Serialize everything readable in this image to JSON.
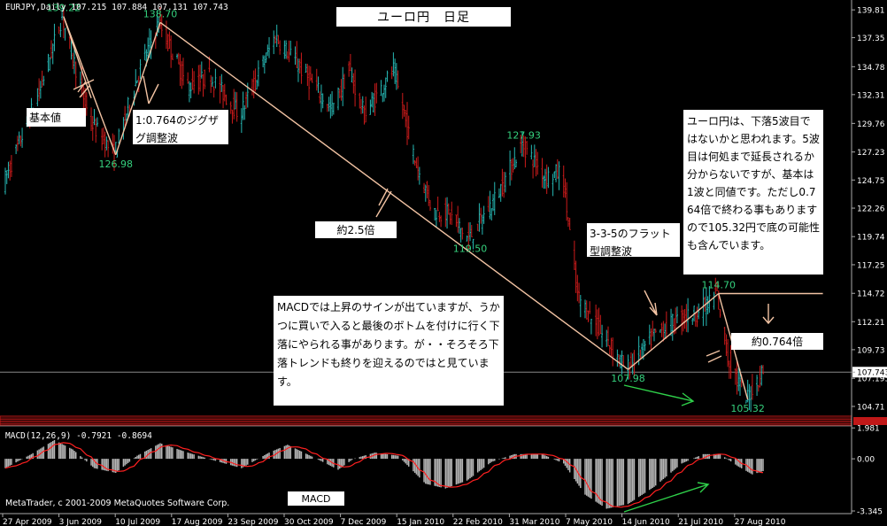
{
  "window": {
    "symbol_header": "EURJPY,Daily  107.215 107.884 107.131 107.743",
    "title_box": "ユーロ円　日足",
    "copyright": "MetaTrader, c 2001-2009 MetaQuotes Software Corp."
  },
  "colors": {
    "background": "#000000",
    "bull_bar": "#26b7b3",
    "bear_bar": "#cc1b1b",
    "wave_line": "#f2c3a3",
    "grid": "#6d6d6d",
    "axis_text": "#ffffff",
    "label_green": "#35d07d",
    "macd_hist": "#b4b4b4",
    "macd_signal": "#ff2020",
    "indicator_band": "#c01818",
    "arrow_green": "#2fd14a"
  },
  "chart_data": [
    {
      "type": "candlestick",
      "title": "EURJPY,Daily",
      "header_values": {
        "open": 107.215,
        "high": 107.884,
        "low": 107.131,
        "close": 107.743
      },
      "ylim": [
        104.0,
        139.9
      ],
      "y_ticks": [
        "139.81",
        "137.35",
        "134.78",
        "132.31",
        "129.76",
        "127.23",
        "124.75",
        "122.26",
        "119.74",
        "117.25",
        "114.72",
        "112.21",
        "109.73",
        "107.743",
        "107.195",
        "104.71"
      ],
      "current_price": 107.743,
      "x_ticks": [
        "27 Apr 2009",
        "3 Jun 2009",
        "10 Jul 2009",
        "17 Aug 2009",
        "23 Sep 2009",
        "30 Oct 2009",
        "7 Dec 2009",
        "15 Jan 2010",
        "22 Feb 2010",
        "31 Mar 2010",
        "7 May 2010",
        "14 Jun 2010",
        "21 Jul 2010",
        "27 Aug 2010"
      ],
      "waypoints": [
        {
          "date": "2009-04-27",
          "price": 124.5
        },
        {
          "date": "2009-05-20",
          "price": 132.5
        },
        {
          "date": "2009-06-04",
          "price": 139.22
        },
        {
          "date": "2009-06-22",
          "price": 130.0
        },
        {
          "date": "2009-07-08",
          "price": 126.98
        },
        {
          "date": "2009-07-22",
          "price": 133.5
        },
        {
          "date": "2009-08-06",
          "price": 138.7
        },
        {
          "date": "2009-08-25",
          "price": 133.0
        },
        {
          "date": "2009-09-08",
          "price": 134.0
        },
        {
          "date": "2009-09-28",
          "price": 130.5
        },
        {
          "date": "2009-10-21",
          "price": 137.5
        },
        {
          "date": "2009-11-27",
          "price": 131.0
        },
        {
          "date": "2009-12-08",
          "price": 134.5
        },
        {
          "date": "2009-12-18",
          "price": 130.5
        },
        {
          "date": "2010-01-06",
          "price": 134.5
        },
        {
          "date": "2010-01-20",
          "price": 126.5
        },
        {
          "date": "2010-02-01",
          "price": 122.0
        },
        {
          "date": "2010-02-11",
          "price": 121.8
        },
        {
          "date": "2010-02-24",
          "price": 119.5
        },
        {
          "date": "2010-03-15",
          "price": 123.5
        },
        {
          "date": "2010-03-31",
          "price": 127.93
        },
        {
          "date": "2010-04-15",
          "price": 125.0
        },
        {
          "date": "2010-04-26",
          "price": 125.5
        },
        {
          "date": "2010-05-06",
          "price": 114.5
        },
        {
          "date": "2010-05-20",
          "price": 111.5
        },
        {
          "date": "2010-06-07",
          "price": 107.98
        },
        {
          "date": "2010-06-25",
          "price": 111.0
        },
        {
          "date": "2010-07-12",
          "price": 112.5
        },
        {
          "date": "2010-07-23",
          "price": 113.0
        },
        {
          "date": "2010-08-05",
          "price": 114.7
        },
        {
          "date": "2010-08-12",
          "price": 109.0
        },
        {
          "date": "2010-08-24",
          "price": 105.32
        },
        {
          "date": "2010-09-03",
          "price": 107.7
        }
      ],
      "price_labels": [
        {
          "text": "139.22",
          "date": "2009-06-04",
          "price": 139.22,
          "where": "above"
        },
        {
          "text": "138.70",
          "date": "2009-08-06",
          "price": 138.7,
          "where": "above"
        },
        {
          "text": "126.98",
          "date": "2009-07-08",
          "price": 126.98,
          "where": "below"
        },
        {
          "text": "127.93",
          "date": "2010-03-31",
          "price": 127.93,
          "where": "above"
        },
        {
          "text": "119.50",
          "date": "2010-02-24",
          "price": 119.5,
          "where": "below"
        },
        {
          "text": "107.98",
          "date": "2010-06-07",
          "price": 107.98,
          "where": "below"
        },
        {
          "text": "114.70",
          "date": "2010-08-05",
          "price": 114.7,
          "where": "above"
        },
        {
          "text": "105.32",
          "date": "2010-08-24",
          "price": 105.32,
          "where": "below"
        }
      ],
      "wave_lines": [
        [
          [
            "2009-06-04",
            139.22
          ],
          [
            "2009-07-08",
            126.98
          ]
        ],
        [
          [
            "2009-07-08",
            126.98
          ],
          [
            "2009-08-06",
            138.7
          ]
        ],
        [
          [
            "2009-06-04",
            139.22
          ],
          [
            "2009-06-22",
            132.0
          ]
        ],
        [
          [
            "2009-08-06",
            138.7
          ],
          [
            "2010-06-07",
            107.98
          ]
        ],
        [
          [
            "2010-06-07",
            107.98
          ],
          [
            "2010-08-05",
            114.7
          ]
        ],
        [
          [
            "2010-08-05",
            114.7
          ],
          [
            "2010-08-24",
            105.32
          ]
        ],
        [
          [
            "2010-08-05",
            114.7
          ],
          [
            "2010-10-12",
            114.7
          ]
        ]
      ],
      "annotations": {
        "kihonchi": "基本値",
        "zigzag": "1:0.764のジグザグ調整波",
        "yaku25": "約2.5倍",
        "flat": "3-3-5のフラット型調整波",
        "yaku0764": "約0.764倍",
        "comment_right": "ユーロ円は、下落5波目ではないかと思われます。5波目は何処まで延長されるか分からないですが、基本は1波と同値です。ただし0.764倍で終わる事もありますので105.32円で底の可能性も含んでいます。",
        "comment_macd": "MACDでは上昇のサインが出ていますが、うかつに買いで入ると最後のボトムを付けに行く下落にやられる事があります。が・・そろそろ下落トレンドも終りを迎えるのではと見ています。"
      }
    },
    {
      "type": "macd",
      "title": "MACD(12,26,9) -0.7921 -0.8694",
      "params": "12,26,9",
      "macd": -0.7921,
      "signal": -0.8694,
      "ylim": [
        -3.4,
        2.05
      ],
      "y_ticks": [
        "1.981",
        "0.00",
        "-3.345"
      ],
      "label": "MACD",
      "waypoints": [
        {
          "date": "2009-04-27",
          "value": -0.6
        },
        {
          "date": "2009-05-14",
          "value": 0.3
        },
        {
          "date": "2009-05-29",
          "value": 1.2
        },
        {
          "date": "2009-06-10",
          "value": 0.6
        },
        {
          "date": "2009-06-24",
          "value": -0.6
        },
        {
          "date": "2009-07-08",
          "value": -0.9
        },
        {
          "date": "2009-07-22",
          "value": 0.2
        },
        {
          "date": "2009-08-06",
          "value": 1.0
        },
        {
          "date": "2009-08-24",
          "value": 0.4
        },
        {
          "date": "2009-09-10",
          "value": -0.1
        },
        {
          "date": "2009-09-28",
          "value": -0.6
        },
        {
          "date": "2009-10-16",
          "value": 0.4
        },
        {
          "date": "2009-10-28",
          "value": 0.9
        },
        {
          "date": "2009-11-16",
          "value": 0.0
        },
        {
          "date": "2009-11-30",
          "value": -0.7
        },
        {
          "date": "2009-12-10",
          "value": 0.0
        },
        {
          "date": "2009-12-24",
          "value": 0.4
        },
        {
          "date": "2010-01-08",
          "value": 0.2
        },
        {
          "date": "2010-01-26",
          "value": -1.6
        },
        {
          "date": "2010-02-08",
          "value": -1.9
        },
        {
          "date": "2010-02-22",
          "value": -1.4
        },
        {
          "date": "2010-03-10",
          "value": -0.2
        },
        {
          "date": "2010-03-25",
          "value": 0.3
        },
        {
          "date": "2010-04-12",
          "value": 0.3
        },
        {
          "date": "2010-04-26",
          "value": -0.3
        },
        {
          "date": "2010-05-10",
          "value": -2.3
        },
        {
          "date": "2010-05-24",
          "value": -3.2
        },
        {
          "date": "2010-06-07",
          "value": -2.9
        },
        {
          "date": "2010-06-24",
          "value": -1.8
        },
        {
          "date": "2010-07-12",
          "value": -0.3
        },
        {
          "date": "2010-07-26",
          "value": 0.3
        },
        {
          "date": "2010-08-06",
          "value": 0.3
        },
        {
          "date": "2010-08-18",
          "value": -0.5
        },
        {
          "date": "2010-08-27",
          "value": -1.0
        },
        {
          "date": "2010-09-03",
          "value": -0.79
        }
      ]
    }
  ]
}
